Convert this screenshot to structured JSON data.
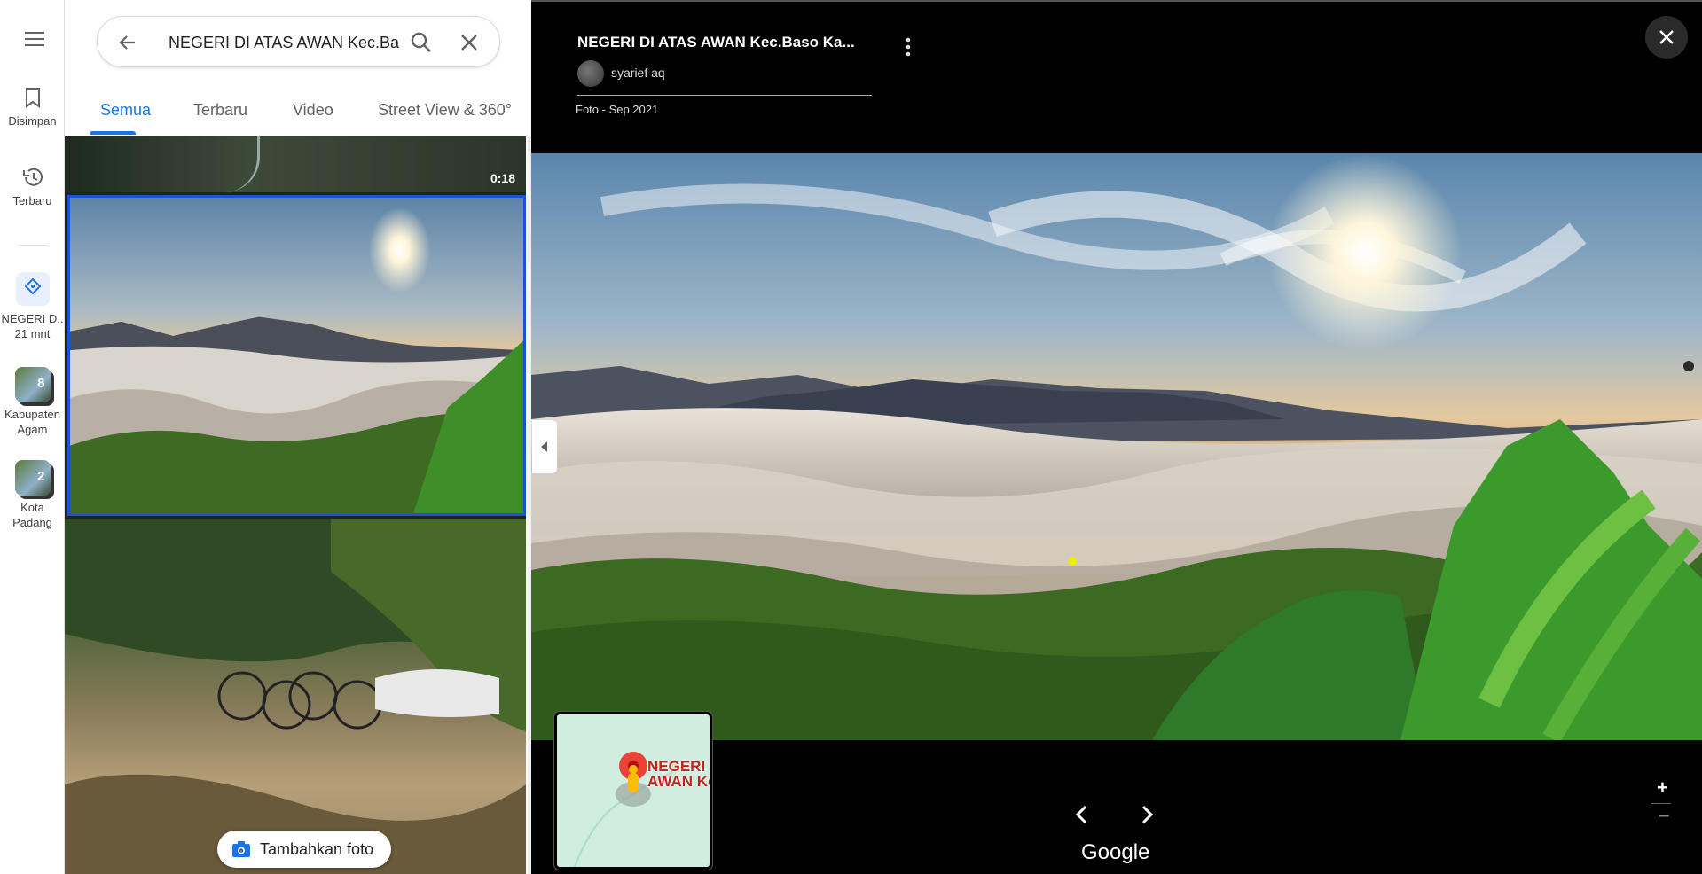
{
  "rail": {
    "saved_label": "Disimpan",
    "recent_label": "Terbaru",
    "recents": [
      {
        "label1": "NEGERI D..",
        "label2": "21 mnt"
      },
      {
        "label1": "Kabupaten",
        "label2": "Agam",
        "badge": "8"
      },
      {
        "label1": "Kota",
        "label2": "Padang",
        "badge": "2"
      }
    ]
  },
  "search": {
    "query": "NEGERI DI ATAS AWAN Kec.Ba"
  },
  "tabs": [
    "Semua",
    "Terbaru",
    "Video",
    "Street View & 360°"
  ],
  "media": {
    "duration": "0:18",
    "add_photo_label": "Tambahkan foto"
  },
  "viewer": {
    "title": "NEGERI DI ATAS AWAN Kec.Baso Ka...",
    "author": "syarief aq",
    "date": "Foto - Sep 2021",
    "map_label_line1": "NEGERI D",
    "map_label_line2": "AWAN Ke",
    "brand": "Google",
    "zoom_in": "+",
    "zoom_out": "−"
  },
  "colors": {
    "accent": "#1a73e8",
    "selected_border": "#1a54d6",
    "viewer_bg": "#000000"
  }
}
